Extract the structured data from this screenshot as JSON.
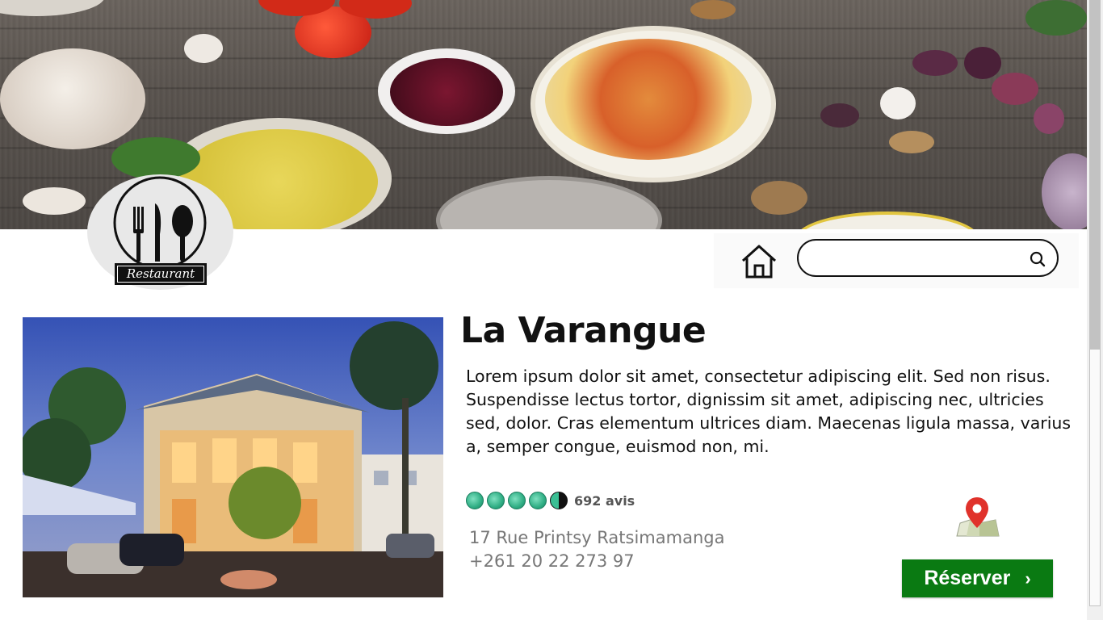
{
  "brand": {
    "logo_text": "Restaurant"
  },
  "header": {
    "search": {
      "value": "",
      "placeholder": ""
    }
  },
  "restaurant": {
    "name": "La Varangue",
    "description": "Lorem ipsum dolor sit amet, consectetur adipiscing elit. Sed non risus. Suspendisse lectus tortor, dignissim sit amet, adipiscing nec, ultricies sed, dolor. Cras elementum ultrices diam. Maecenas ligula massa, varius a, semper congue, euismod non, mi.",
    "rating": 4.5,
    "rating_max": 5,
    "reviews_label": "692 avis",
    "address": "17 Rue Printsy Ratsimamanga",
    "phone": "+261 20 22 273 97",
    "reserve_label": "Réserver",
    "reserve_chevron": "›"
  },
  "icons": {
    "home": "home-icon",
    "search": "search-icon",
    "map": "map-pin-icon",
    "rating": "rating-bubble-icon"
  },
  "colors": {
    "reserve_button": "#0a7a12",
    "rating_bubble": "#3bbf94",
    "map_pin": "#e0322b"
  }
}
